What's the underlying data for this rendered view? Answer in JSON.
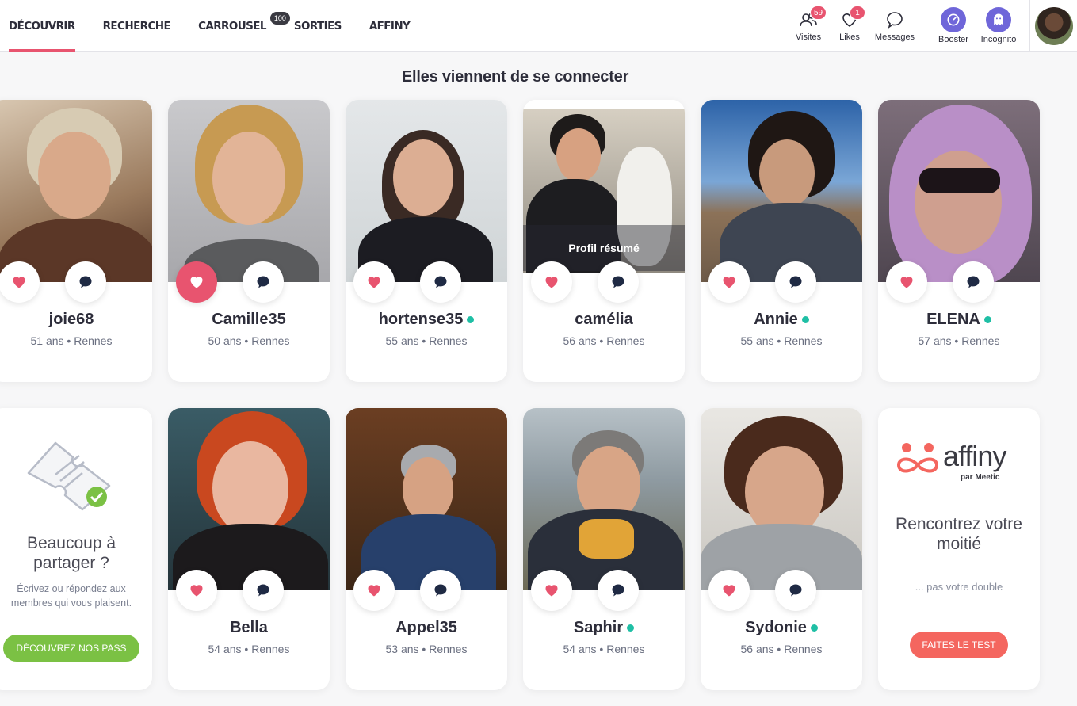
{
  "nav": {
    "items": [
      {
        "label": "DÉCOUVRIR",
        "active": true
      },
      {
        "label": "RECHERCHE"
      },
      {
        "label": "CARROUSEL",
        "badge": "100"
      },
      {
        "label": "SORTIES"
      },
      {
        "label": "AFFINY"
      }
    ]
  },
  "actions": {
    "visites": {
      "label": "Visites",
      "badge": "59"
    },
    "likes": {
      "label": "Likes",
      "badge": "1"
    },
    "messages": {
      "label": "Messages"
    },
    "booster": {
      "label": "Booster"
    },
    "incognito": {
      "label": "Incognito"
    }
  },
  "section_title": "Elles viennent de se connecter",
  "profiles": [
    {
      "name": "joie68",
      "meta": "51 ans • Rennes",
      "online": false,
      "liked": false
    },
    {
      "name": "Camille35",
      "meta": "50 ans • Rennes",
      "online": false,
      "liked": true
    },
    {
      "name": "hortense35",
      "meta": "55 ans • Rennes",
      "online": true,
      "liked": false
    },
    {
      "name": "camélia",
      "meta": "56 ans • Rennes",
      "online": false,
      "liked": false,
      "overlay": "Profil résumé"
    },
    {
      "name": "Annie",
      "meta": "55 ans • Rennes",
      "online": true,
      "liked": false
    },
    {
      "name": "ELENA",
      "meta": "57 ans • Rennes",
      "online": true,
      "liked": false
    },
    {
      "name": "Bella",
      "meta": "54 ans • Rennes",
      "online": false,
      "liked": false
    },
    {
      "name": "Appel35",
      "meta": "53 ans • Rennes",
      "online": false,
      "liked": false
    },
    {
      "name": "Saphir",
      "meta": "54 ans • Rennes",
      "online": true,
      "liked": false
    },
    {
      "name": "Sydonie",
      "meta": "56 ans • Rennes",
      "online": true,
      "liked": false
    }
  ],
  "promo_pass": {
    "title": "Beaucoup à partager ?",
    "description": "Écrivez ou répondez aux membres qui vous plaisent.",
    "button": "DÉCOUVREZ NOS PASS"
  },
  "promo_affiny": {
    "logo_text": "affiny",
    "logo_sub": "par Meetic",
    "title": "Rencontrez votre moitié",
    "subtitle": "... pas votre double",
    "button": "FAITES LE TEST"
  },
  "colors": {
    "accent": "#e8546f",
    "online": "#1fbfa5",
    "pass_button": "#7bc144",
    "affiny_button": "#f4665f",
    "booster": "#6f66d9"
  }
}
